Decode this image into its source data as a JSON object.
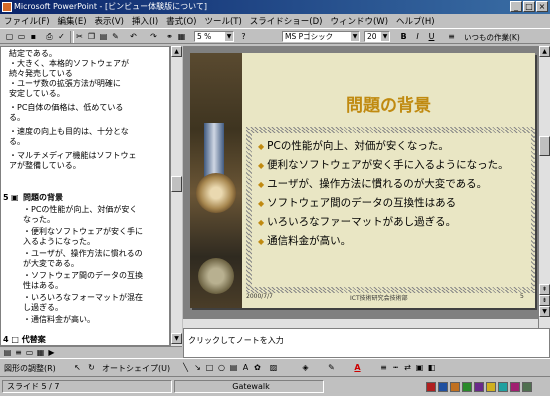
{
  "window": {
    "title": "Microsoft PowerPoint - [ビンビュー体験版について]",
    "buttons": [
      "_",
      "□",
      "×"
    ]
  },
  "menubar": {
    "items": [
      "ファイル(F)",
      "編集(E)",
      "表示(V)",
      "挿入(I)",
      "書式(O)",
      "ツール(T)",
      "スライドショー(D)",
      "ウィンドウ(W)",
      "ヘルプ(H)"
    ]
  },
  "toolbar": {
    "zoom": "5 %",
    "font": "MS Pゴシック",
    "font_size": "20",
    "bold": "B",
    "italic": "I",
    "underline": "U",
    "common_tasks": "いつもの作業(K)"
  },
  "outline": {
    "lines": [
      "結定である。",
      "・大きく、本格的ソフトウェアが",
      "  続々発売している",
      "・ユーザ数の拡張方法が明確に",
      "  安定している。",
      "・PC自体の価格は、低めている",
      "  る。",
      "・速度の向上も目的は、十分とな",
      "  る。",
      "・マルチメディア機能はソフトウェ",
      "  アが整備している。"
    ],
    "slide_number": "5",
    "slide_title": "問題の背景",
    "slide_lines": [
      "・PCの性能が向上、対価が安く",
      "  なった。",
      "・便利なソフトウェアが安く手に",
      "  入るようになった。",
      "・ユーザが、操作方法に慣れるの",
      "  が大変である。",
      "・ソフトウェア間のデータの互換",
      "  性はある。",
      "・いろいろなフォーマットが混在",
      "  し過ぎる。",
      "・通信料金が高い。"
    ],
    "next_slide": "4 □ 代替案"
  },
  "slide": {
    "title": "問題の背景",
    "bullets": [
      "PCの性能が向上、対価が安くなった。",
      "便利なソフトウェアが安く手に入るようになった。",
      "ユーザが、操作方法に慣れるのが大変である。",
      "ソフトウェア間のデータの互換性はある",
      "いろいろなファーマットがあし過ぎる。",
      "通信料金が高い。"
    ],
    "footer_date": "2000/7/7",
    "footer_text": "ICT技術研究会技術部",
    "footer_num": "5",
    "accent": "#c08a10",
    "background": "#e9e6c4"
  },
  "notes": {
    "placeholder": "クリックしてノートを入力"
  },
  "drawbar": {
    "draw_label": "図形の調整(R)",
    "autoshapes_label": "オートシェイプ(U)"
  },
  "status": {
    "slide": "スライド 5 / 7",
    "design": "Gatewalk"
  }
}
